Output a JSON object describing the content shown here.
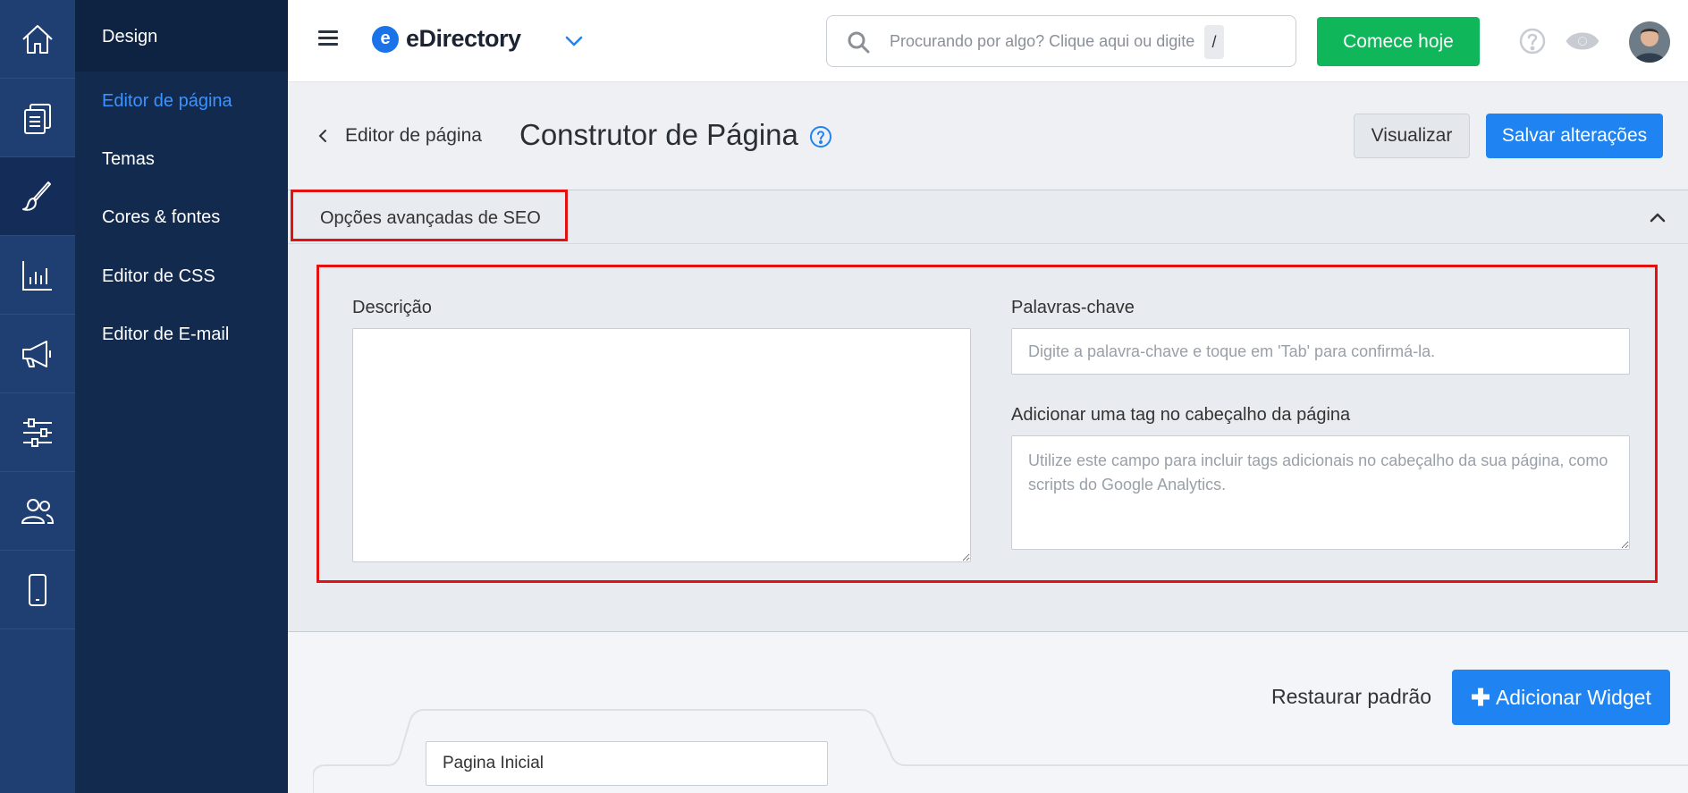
{
  "rail": {
    "items": [
      {
        "name": "home-icon",
        "active": false
      },
      {
        "name": "pages-icon",
        "active": false
      },
      {
        "name": "brush-icon",
        "active": true
      },
      {
        "name": "chart-icon",
        "active": false
      },
      {
        "name": "megaphone-icon",
        "active": false
      },
      {
        "name": "sliders-icon",
        "active": false
      },
      {
        "name": "users-icon",
        "active": false
      },
      {
        "name": "mobile-icon",
        "active": false
      }
    ]
  },
  "sidenav": {
    "header": "Design",
    "items": [
      {
        "label": "Editor de página",
        "active": true
      },
      {
        "label": "Temas",
        "active": false
      },
      {
        "label": "Cores & fontes",
        "active": false
      },
      {
        "label": "Editor de CSS",
        "active": false
      },
      {
        "label": "Editor de E-mail",
        "active": false
      }
    ]
  },
  "topbar": {
    "brand_mark": "e",
    "brand_name": "eDirectory",
    "search_placeholder": "Procurando por algo? Clique aqui ou digite",
    "search_shortcut": "/",
    "cta_label": "Comece hoje"
  },
  "header": {
    "back_label": "Editor de página",
    "title": "Construtor de Página",
    "preview_label": "Visualizar",
    "save_label": "Salvar alterações"
  },
  "seo": {
    "title": "Opções avançadas de SEO",
    "description_label": "Descrição",
    "description_value": "",
    "keywords_label": "Palavras-chave",
    "keywords_placeholder": "Digite a palavra-chave e toque em 'Tab' para confirmá-la.",
    "head_tag_label": "Adicionar uma tag no cabeçalho da página",
    "head_tag_placeholder": "Utilize este campo para incluir tags adicionais no cabeçalho da sua página, como scripts do Google Analytics."
  },
  "widgets": {
    "restore_label": "Restaurar padrão",
    "add_label": "Adicionar Widget",
    "page_name_value": "Pagina Inicial"
  },
  "colors": {
    "primary": "#1f83f2",
    "cta": "#0fb75a",
    "rail": "#1f3f73",
    "sidenav": "#132a4f",
    "highlight": "#e21212"
  }
}
